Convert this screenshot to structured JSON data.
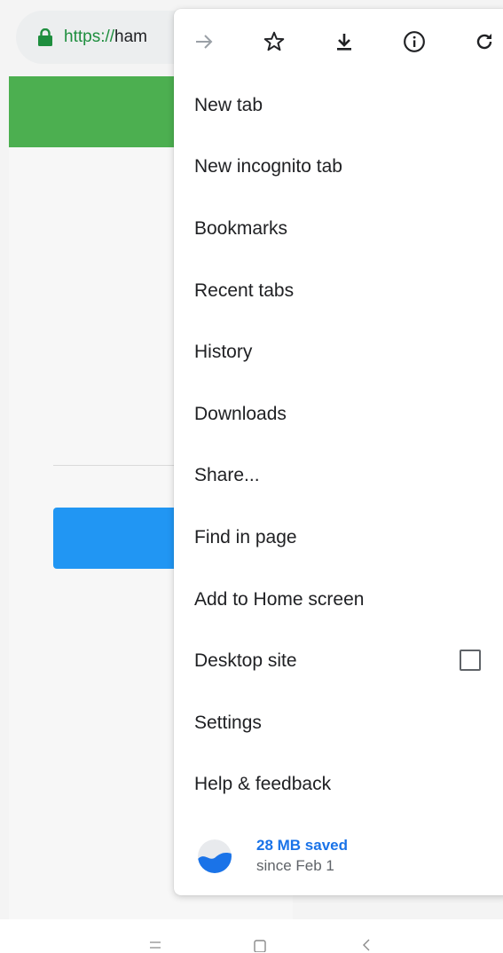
{
  "address_bar": {
    "scheme": "https://",
    "host_fragment": "ham"
  },
  "toolbar": {
    "icons": [
      "forward-arrow-icon",
      "bookmark-star-icon",
      "download-icon",
      "info-icon",
      "reload-icon"
    ]
  },
  "menu": {
    "items": [
      {
        "label": "New tab"
      },
      {
        "label": "New incognito tab"
      },
      {
        "label": "Bookmarks"
      },
      {
        "label": "Recent tabs"
      },
      {
        "label": "History"
      },
      {
        "label": "Downloads"
      },
      {
        "label": "Share..."
      },
      {
        "label": "Find in page"
      },
      {
        "label": "Add to Home screen"
      },
      {
        "label": "Desktop site"
      },
      {
        "label": "Settings"
      },
      {
        "label": "Help & feedback"
      }
    ],
    "desktop_site_checked": false
  },
  "data_saver": {
    "amount": "28 MB saved",
    "since": "since Feb 1"
  },
  "colors": {
    "accent_blue": "#1a73e8",
    "header_green": "#4caf50",
    "button_blue": "#2196f3",
    "lock_green": "#1e8e3e"
  }
}
